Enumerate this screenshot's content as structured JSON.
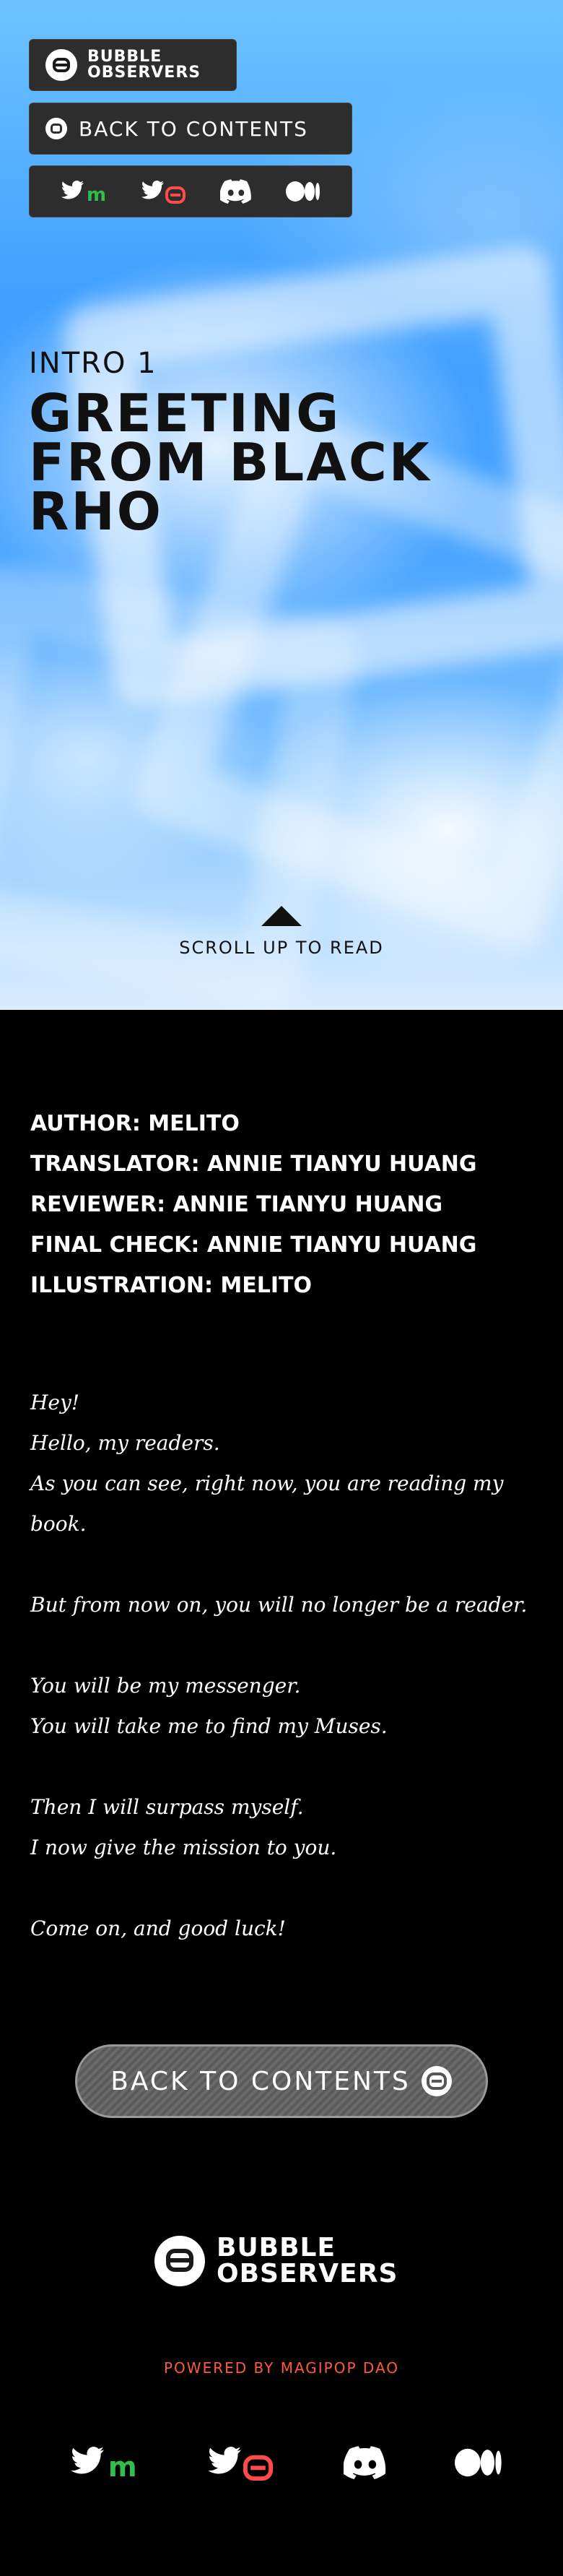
{
  "brand": {
    "line1": "BUBBLE",
    "line2": "OBSERVERS"
  },
  "nav": {
    "back_label": "BACK TO CONTENTS"
  },
  "social": [
    {
      "icon": "twitter-mirror-icon",
      "badge": "m",
      "badge_color": "#2fbf4a"
    },
    {
      "icon": "twitter-bubble-icon",
      "badge": "e",
      "badge_color": "#ff4b4b"
    },
    {
      "icon": "discord-icon"
    },
    {
      "icon": "medium-icon"
    }
  ],
  "hero": {
    "intro_label": "INTRO 1",
    "title": "GREETING FROM BLACK RHO",
    "scroll_hint": "SCROLL UP TO READ"
  },
  "credits": {
    "author": "AUTHOR: MELITO",
    "translator": "TRANSLATOR: ANNIE TIANYU HUANG",
    "reviewer": "REVIEWER: ANNIE TIANYU HUANG",
    "final_check": "FINAL CHECK: ANNIE TIANYU HUANG",
    "illustration": "ILLUSTRATION: MELITO"
  },
  "story": [
    "Hey!",
    "Hello, my readers.",
    "As you can see, right now, you are reading my book.",
    "",
    "But from now on, you will no longer be a reader.",
    "",
    "You will be my messenger.",
    "You will take me to find my Muses.",
    "",
    "Then I will surpass myself.",
    "I now give the mission to you.",
    "",
    "Come on, and good luck!"
  ],
  "footer": {
    "back_button": "BACK TO CONTENTS",
    "powered_by": "POWERED BY MAGIPOP DAO"
  }
}
